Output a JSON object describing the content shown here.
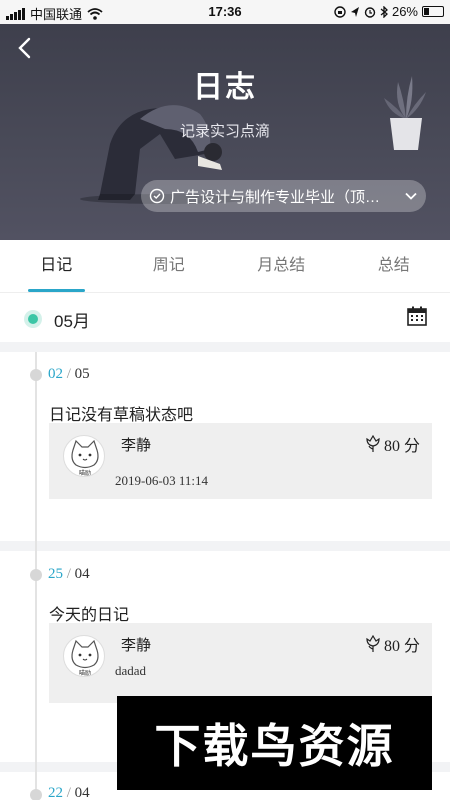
{
  "status_bar": {
    "carrier": "中国联通",
    "time": "17:36",
    "battery": "26%"
  },
  "header": {
    "title": "日志",
    "subtitle": "记录实习点滴",
    "major_select": "广告设计与制作专业毕业（顶…"
  },
  "tabs": [
    {
      "label": "日记",
      "active": true
    },
    {
      "label": "周记",
      "active": false
    },
    {
      "label": "月总结",
      "active": false
    },
    {
      "label": "总结",
      "active": false
    }
  ],
  "month": "05月",
  "entries": [
    {
      "day": "02",
      "sep": "/",
      "month": "05",
      "title": "日记没有草稿状态吧",
      "name": "李静",
      "score": "80 分",
      "content": "",
      "time": "2019-06-03 11:14"
    },
    {
      "day": "25",
      "sep": "/",
      "month": "04",
      "title": "今天的日记",
      "name": "李静",
      "score": "80 分",
      "content": "dadad",
      "time": ""
    },
    {
      "day": "22",
      "sep": "/",
      "month": "04",
      "title": "",
      "name": "",
      "score": "",
      "content": "",
      "time": ""
    }
  ],
  "avatar_caption": "喵励",
  "watermark": "下载鸟资源",
  "colors": {
    "accent": "#2aa6c9",
    "month_dot": "#3cc6a6",
    "header_bg": "#44454f"
  }
}
